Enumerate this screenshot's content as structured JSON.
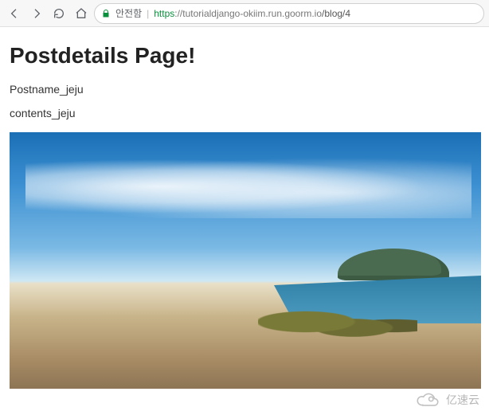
{
  "toolbar": {
    "insecure_label": "안전함",
    "url_https": "https",
    "url_host": "://tutorialdjango-okiim.run.goorm.io",
    "url_path": "/blog/4"
  },
  "page": {
    "heading": "Postdetails Page!",
    "postname": "Postname_jeju",
    "contents": "contents_jeju"
  },
  "watermark": {
    "text": "亿速云"
  },
  "icons": {
    "back": "back-icon",
    "forward": "forward-icon",
    "reload": "reload-icon",
    "home": "home-icon",
    "lock": "lock-icon"
  }
}
